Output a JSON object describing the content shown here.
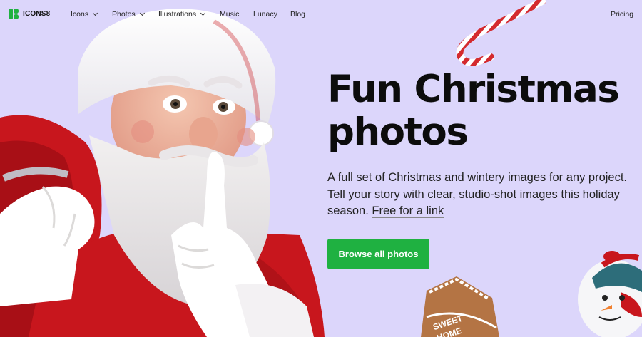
{
  "brand": {
    "name": "ICONS8",
    "color": "#1fb141"
  },
  "nav": {
    "items": [
      {
        "label": "Icons",
        "dropdown": true
      },
      {
        "label": "Photos",
        "dropdown": true
      },
      {
        "label": "Illustrations",
        "dropdown": true
      },
      {
        "label": "Music",
        "dropdown": false
      },
      {
        "label": "Lunacy",
        "dropdown": false
      },
      {
        "label": "Blog",
        "dropdown": false
      }
    ],
    "pricing": "Pricing"
  },
  "hero": {
    "title_line1": "Fun Christmas",
    "title_line2": "photos",
    "description": "A full set of Christmas and wintery images for any project. Tell your story with clear, studio-shot images this holiday season.",
    "link": "Free for a link",
    "cta": "Browse all photos"
  },
  "decor": {
    "cookie_line1": "SWEET",
    "cookie_line2": "HOME"
  },
  "colors": {
    "background": "#dcd6fb",
    "accent": "#1fb141",
    "santa_red": "#c8161d"
  },
  "icons": [
    "logo-icon",
    "chevron-down-icon"
  ]
}
